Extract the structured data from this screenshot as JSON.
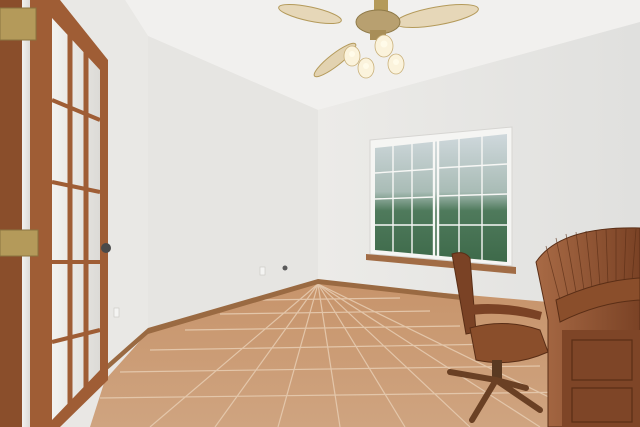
{
  "scene": {
    "description_tags": [
      "room-interior",
      "ceiling-fan",
      "window",
      "french-door",
      "roll-top-desk",
      "office-chair",
      "tile-floor"
    ],
    "colors": {
      "ceiling": "#f1f0ee",
      "wall_left": "#e7e6e3",
      "wall_back": "#eeedea",
      "wall_right": "#e4e4e2",
      "floor": "#c99a72",
      "grout": "#e3c8ad",
      "baseboard": "#9a6a42",
      "wood": "#9a5a34",
      "wood_dark": "#6a3a1f",
      "window_trim": "#f5f5f3",
      "window_glass": "#6f8f85",
      "brass": "#b49a5a"
    }
  }
}
